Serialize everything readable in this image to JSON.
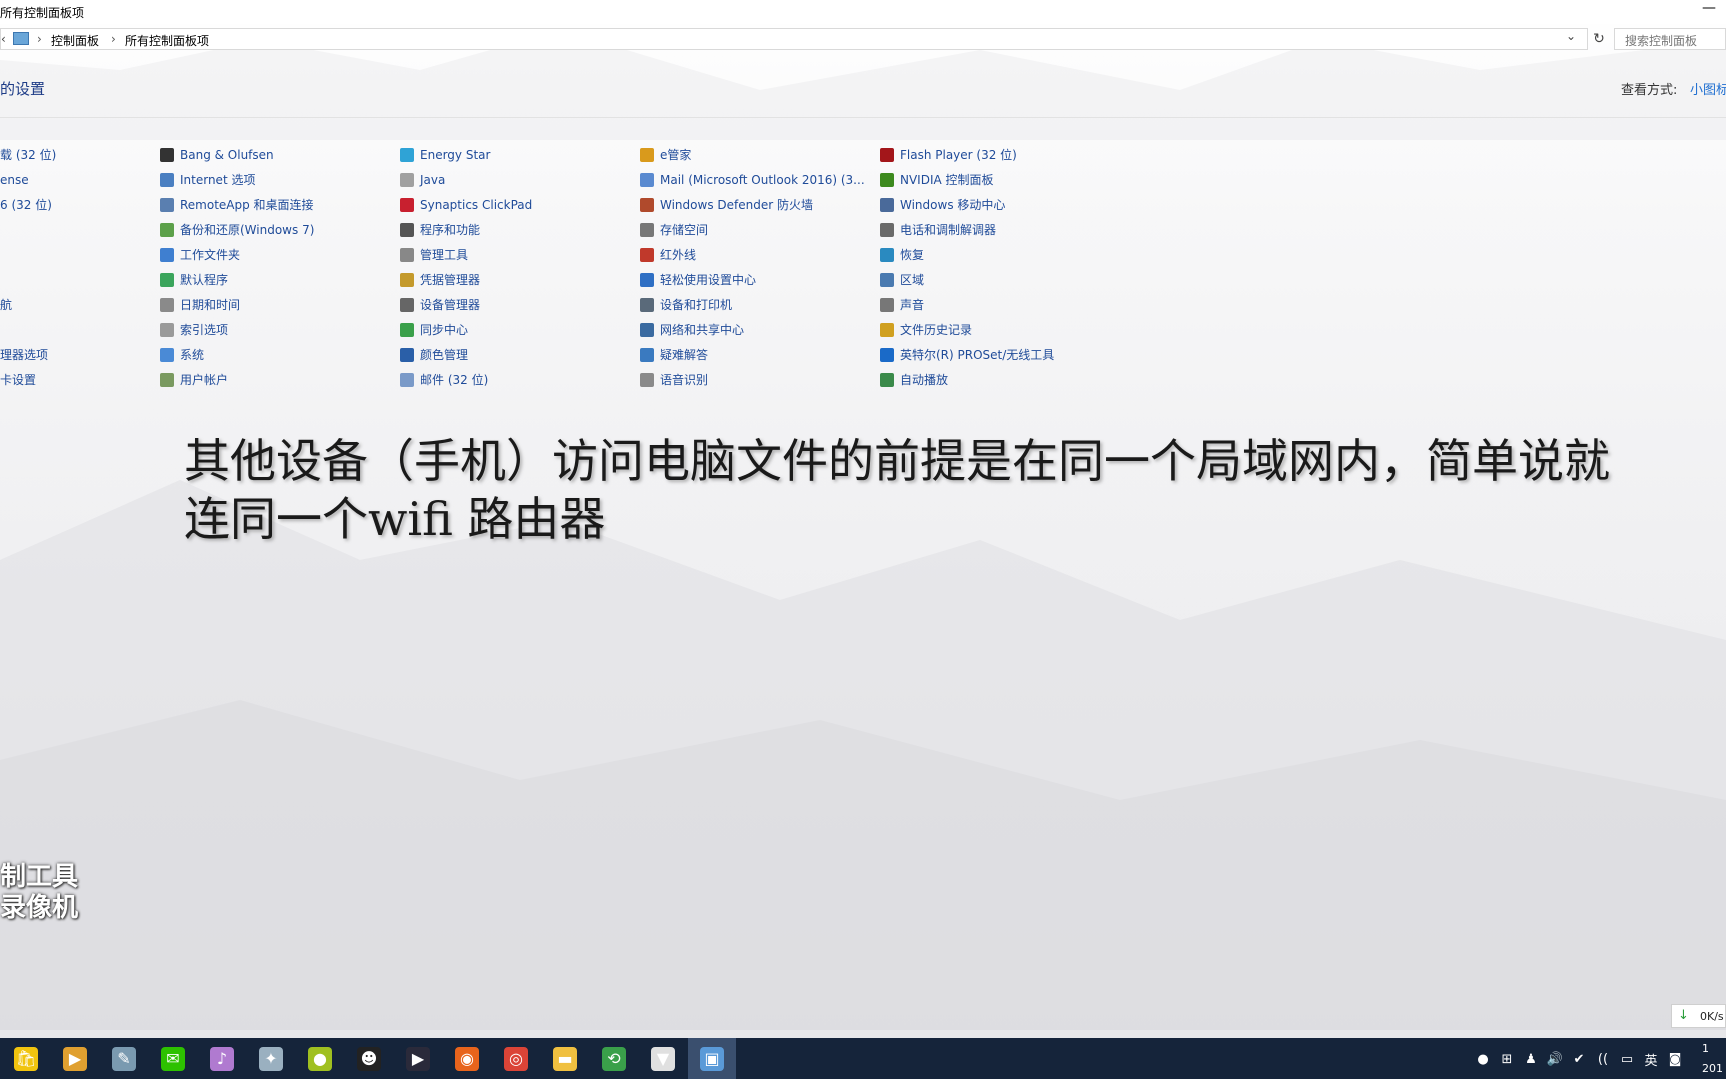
{
  "window": {
    "title": "所有控制面板项",
    "minimize_glyph": "—"
  },
  "address_bar": {
    "back_glyph": "‹",
    "breadcrumbs": [
      "控制面板",
      "所有控制面板项"
    ],
    "separator": "›",
    "dropdown_glyph": "⌄",
    "refresh_glyph": "↻",
    "search_placeholder": "搜索控制面板"
  },
  "content": {
    "heading": "的设置",
    "view_by_label": "查看方式:",
    "view_by_value": "小图标"
  },
  "columns": [
    [
      {
        "label": "载 (32 位)",
        "icon": "partial-icon",
        "color": "#7a7a7a"
      },
      {
        "label": "ense",
        "icon": "partial-icon",
        "color": "#7a7a7a"
      },
      {
        "label": "6 (32 位)",
        "icon": "partial-icon",
        "color": "#7a7a7a"
      },
      {
        "label": "",
        "icon": "partial-icon",
        "color": "#7a7a7a"
      },
      {
        "label": "",
        "icon": "partial-icon",
        "color": "#7a7a7a"
      },
      {
        "label": "",
        "icon": "partial-icon",
        "color": "#7a7a7a"
      },
      {
        "label": "航",
        "icon": "partial-icon",
        "color": "#7a7a7a"
      },
      {
        "label": "",
        "icon": "partial-icon",
        "color": "#7a7a7a"
      },
      {
        "label": "理器选项",
        "icon": "partial-icon",
        "color": "#7a7a7a"
      },
      {
        "label": "卡设置",
        "icon": "partial-icon",
        "color": "#7a7a7a"
      }
    ],
    [
      {
        "label": "Bang & Olufsen",
        "icon": "bang-olufsen-icon",
        "color": "#333333"
      },
      {
        "label": "Internet 选项",
        "icon": "internet-options-icon",
        "color": "#4a7fc1"
      },
      {
        "label": "RemoteApp 和桌面连接",
        "icon": "remoteapp-icon",
        "color": "#5a7fb0"
      },
      {
        "label": "备份和还原(Windows 7)",
        "icon": "backup-restore-icon",
        "color": "#5ca04a"
      },
      {
        "label": "工作文件夹",
        "icon": "work-folders-icon",
        "color": "#3f7fd0"
      },
      {
        "label": "默认程序",
        "icon": "default-programs-icon",
        "color": "#3ba55c"
      },
      {
        "label": "日期和时间",
        "icon": "date-time-icon",
        "color": "#8a8a8a"
      },
      {
        "label": "索引选项",
        "icon": "indexing-icon",
        "color": "#9a9a9a"
      },
      {
        "label": "系统",
        "icon": "system-icon",
        "color": "#4a8ad6"
      },
      {
        "label": "用户帐户",
        "icon": "user-accounts-icon",
        "color": "#7a9a60"
      }
    ],
    [
      {
        "label": "Energy Star",
        "icon": "energy-star-icon",
        "color": "#2fa3d6"
      },
      {
        "label": "Java",
        "icon": "java-icon",
        "color": "#a0a0a0"
      },
      {
        "label": "Synaptics ClickPad",
        "icon": "synaptics-icon",
        "color": "#c8202f"
      },
      {
        "label": "程序和功能",
        "icon": "programs-features-icon",
        "color": "#555555"
      },
      {
        "label": "管理工具",
        "icon": "admin-tools-icon",
        "color": "#888888"
      },
      {
        "label": "凭据管理器",
        "icon": "credential-manager-icon",
        "color": "#c49a2c"
      },
      {
        "label": "设备管理器",
        "icon": "device-manager-icon",
        "color": "#666666"
      },
      {
        "label": "同步中心",
        "icon": "sync-center-icon",
        "color": "#3aa04a"
      },
      {
        "label": "颜色管理",
        "icon": "color-management-icon",
        "color": "#2a5fa8"
      },
      {
        "label": "邮件 (32 位)",
        "icon": "mail-icon",
        "color": "#7a9ac8"
      }
    ],
    [
      {
        "label": "e管家",
        "icon": "e-guanjia-icon",
        "color": "#d99a1c"
      },
      {
        "label": "Mail (Microsoft Outlook 2016) (3...",
        "icon": "outlook-mail-icon",
        "color": "#5a8ad0"
      },
      {
        "label": "Windows Defender 防火墙",
        "icon": "defender-firewall-icon",
        "color": "#b04a2c"
      },
      {
        "label": "存储空间",
        "icon": "storage-spaces-icon",
        "color": "#777777"
      },
      {
        "label": "红外线",
        "icon": "infrared-icon",
        "color": "#c0392b"
      },
      {
        "label": "轻松使用设置中心",
        "icon": "ease-of-access-icon",
        "color": "#2f6fc4"
      },
      {
        "label": "设备和打印机",
        "icon": "devices-printers-icon",
        "color": "#5a6a7a"
      },
      {
        "label": "网络和共享中心",
        "icon": "network-sharing-icon",
        "color": "#3a6aa0"
      },
      {
        "label": "疑难解答",
        "icon": "troubleshooting-icon",
        "color": "#3a7ac0"
      },
      {
        "label": "语音识别",
        "icon": "speech-recognition-icon",
        "color": "#8a8a8a"
      }
    ],
    [
      {
        "label": "Flash Player (32 位)",
        "icon": "flash-player-icon",
        "color": "#a3161a"
      },
      {
        "label": "NVIDIA 控制面板",
        "icon": "nvidia-icon",
        "color": "#3d8a1e"
      },
      {
        "label": "Windows 移动中心",
        "icon": "mobility-center-icon",
        "color": "#4a6a9a"
      },
      {
        "label": "电话和调制解调器",
        "icon": "phone-modem-icon",
        "color": "#6a6a6a"
      },
      {
        "label": "恢复",
        "icon": "recovery-icon",
        "color": "#2a8ac0"
      },
      {
        "label": "区域",
        "icon": "region-icon",
        "color": "#4a7ab0"
      },
      {
        "label": "声音",
        "icon": "sound-icon",
        "color": "#777777"
      },
      {
        "label": "文件历史记录",
        "icon": "file-history-icon",
        "color": "#d0a020"
      },
      {
        "label": "英特尔(R) PROSet/无线工具",
        "icon": "intel-proset-icon",
        "color": "#1a6ac8"
      },
      {
        "label": "自动播放",
        "icon": "autoplay-icon",
        "color": "#3a8a4a"
      }
    ]
  ],
  "overlay_caption": {
    "line1": "其他设备（手机）访问电脑文件的前提是在同一个局域网内，简单说就",
    "line2": "连同一个wifi 路由器"
  },
  "watermark": {
    "line1": "制工具",
    "line2": "录像机"
  },
  "download_speed": {
    "arrow": "↓",
    "value": "0K/s"
  },
  "taskbar": {
    "apps": [
      {
        "name": "store-app",
        "glyph": "🛍",
        "color": "#f1c40f"
      },
      {
        "name": "video-player-app",
        "glyph": "▶",
        "color": "#e0a030"
      },
      {
        "name": "paint-app",
        "glyph": "✎",
        "color": "#7a9ab0"
      },
      {
        "name": "wechat-app",
        "glyph": "✉",
        "color": "#2dc100"
      },
      {
        "name": "music-app",
        "glyph": "♪",
        "color": "#b07ad0"
      },
      {
        "name": "game-app",
        "glyph": "✦",
        "color": "#9ab0c0"
      },
      {
        "name": "green-app",
        "glyph": "●",
        "color": "#a0c020"
      },
      {
        "name": "qq-app",
        "glyph": "☻",
        "color": "#222222"
      },
      {
        "name": "media-app",
        "glyph": "▶",
        "color": "#2a2a3a"
      },
      {
        "name": "firefox-app",
        "glyph": "◉",
        "color": "#e8641c"
      },
      {
        "name": "chrome-app",
        "glyph": "◎",
        "color": "#db4437"
      },
      {
        "name": "file-explorer-app",
        "glyph": "▬",
        "color": "#f0c040"
      },
      {
        "name": "network-app",
        "glyph": "⟲",
        "color": "#3aa04a"
      },
      {
        "name": "fox-app",
        "glyph": "▼",
        "color": "#e0e0e0"
      },
      {
        "name": "control-panel-app",
        "glyph": "▣",
        "color": "#5a9ad8"
      }
    ],
    "tray": [
      "●",
      "⊞",
      "♟",
      "🔊",
      "✔",
      "((",
      "▭",
      "英",
      "◙"
    ],
    "clock_line1": "1",
    "clock_line2": "201"
  }
}
